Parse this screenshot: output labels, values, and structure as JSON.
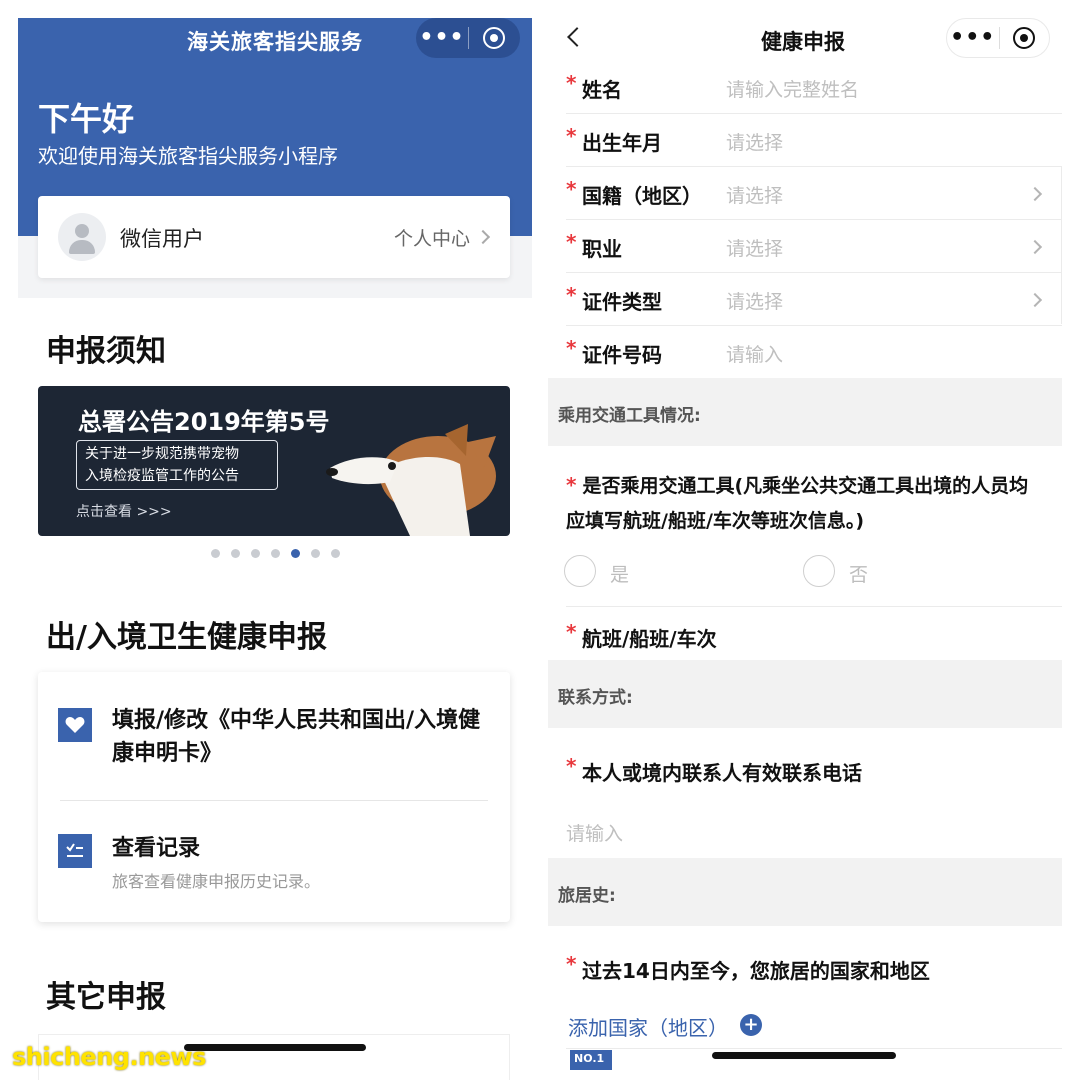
{
  "left": {
    "app_title": "海关旅客指尖服务",
    "greeting": "下午好",
    "welcome": "欢迎使用海关旅客指尖服务小程序",
    "user": {
      "name": "微信用户",
      "center": "个人中心"
    },
    "notice_title": "申报须知",
    "banner": {
      "title": "总署公告2019年第5号",
      "box_line1": "关于进一步规范携带宠物",
      "box_line2": "入境检疫监管工作的公告",
      "link": "点击查看 >>>",
      "active_dot": 5,
      "dot_count": 7
    },
    "health_title": "出/入境卫生健康申报",
    "health_items": [
      {
        "title": "填报/修改《中华人民共和国出/入境健康申明卡》",
        "sub": ""
      },
      {
        "title": "查看记录",
        "sub": "旅客查看健康申报历史记录。"
      }
    ],
    "other_title": "其它申报"
  },
  "right": {
    "nav_title": "健康申报",
    "fields": [
      {
        "label": "姓名",
        "placeholder": "请输入完整姓名",
        "arrow": false
      },
      {
        "label": "出生年月",
        "placeholder": "请选择",
        "arrow": false
      },
      {
        "label": "国籍（地区）",
        "placeholder": "请选择",
        "arrow": true
      },
      {
        "label": "职业",
        "placeholder": "请选择",
        "arrow": true
      },
      {
        "label": "证件类型",
        "placeholder": "请选择",
        "arrow": true
      },
      {
        "label": "证件号码",
        "placeholder": "请输入",
        "arrow": false
      }
    ],
    "band_transport": "乘用交通工具情况:",
    "q_transport": "是否乘用交通工具(凡乘坐公共交通工具出境的人员均应填写航班/船班/车次等班次信息。)",
    "radio_yes": "是",
    "radio_no": "否",
    "flight_label": "航班/船班/车次",
    "band_contact": "联系方式:",
    "phone_label": "本人或境内联系人有效联系电话",
    "phone_placeholder": "请输入",
    "band_travel": "旅居史:",
    "travel_q": "过去14日内至今，您旅居的国家和地区",
    "add_country": "添加国家（地区）",
    "add_plus": "+",
    "no1": "NO.1"
  },
  "watermark": "shicheng.news",
  "colors": {
    "brand_blue": "#3a63ad",
    "required_red": "#e8383d"
  }
}
